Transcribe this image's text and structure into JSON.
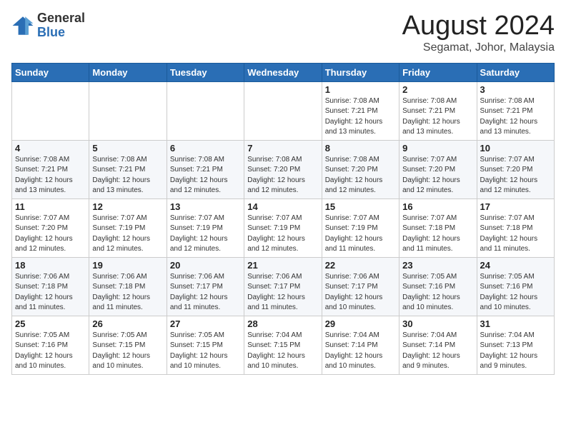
{
  "header": {
    "logo_general": "General",
    "logo_blue": "Blue",
    "month_year": "August 2024",
    "location": "Segamat, Johor, Malaysia"
  },
  "weekdays": [
    "Sunday",
    "Monday",
    "Tuesday",
    "Wednesday",
    "Thursday",
    "Friday",
    "Saturday"
  ],
  "weeks": [
    [
      {
        "day": "",
        "info": ""
      },
      {
        "day": "",
        "info": ""
      },
      {
        "day": "",
        "info": ""
      },
      {
        "day": "",
        "info": ""
      },
      {
        "day": "1",
        "info": "Sunrise: 7:08 AM\nSunset: 7:21 PM\nDaylight: 12 hours\nand 13 minutes."
      },
      {
        "day": "2",
        "info": "Sunrise: 7:08 AM\nSunset: 7:21 PM\nDaylight: 12 hours\nand 13 minutes."
      },
      {
        "day": "3",
        "info": "Sunrise: 7:08 AM\nSunset: 7:21 PM\nDaylight: 12 hours\nand 13 minutes."
      }
    ],
    [
      {
        "day": "4",
        "info": "Sunrise: 7:08 AM\nSunset: 7:21 PM\nDaylight: 12 hours\nand 13 minutes."
      },
      {
        "day": "5",
        "info": "Sunrise: 7:08 AM\nSunset: 7:21 PM\nDaylight: 12 hours\nand 13 minutes."
      },
      {
        "day": "6",
        "info": "Sunrise: 7:08 AM\nSunset: 7:21 PM\nDaylight: 12 hours\nand 12 minutes."
      },
      {
        "day": "7",
        "info": "Sunrise: 7:08 AM\nSunset: 7:20 PM\nDaylight: 12 hours\nand 12 minutes."
      },
      {
        "day": "8",
        "info": "Sunrise: 7:08 AM\nSunset: 7:20 PM\nDaylight: 12 hours\nand 12 minutes."
      },
      {
        "day": "9",
        "info": "Sunrise: 7:07 AM\nSunset: 7:20 PM\nDaylight: 12 hours\nand 12 minutes."
      },
      {
        "day": "10",
        "info": "Sunrise: 7:07 AM\nSunset: 7:20 PM\nDaylight: 12 hours\nand 12 minutes."
      }
    ],
    [
      {
        "day": "11",
        "info": "Sunrise: 7:07 AM\nSunset: 7:20 PM\nDaylight: 12 hours\nand 12 minutes."
      },
      {
        "day": "12",
        "info": "Sunrise: 7:07 AM\nSunset: 7:19 PM\nDaylight: 12 hours\nand 12 minutes."
      },
      {
        "day": "13",
        "info": "Sunrise: 7:07 AM\nSunset: 7:19 PM\nDaylight: 12 hours\nand 12 minutes."
      },
      {
        "day": "14",
        "info": "Sunrise: 7:07 AM\nSunset: 7:19 PM\nDaylight: 12 hours\nand 12 minutes."
      },
      {
        "day": "15",
        "info": "Sunrise: 7:07 AM\nSunset: 7:19 PM\nDaylight: 12 hours\nand 11 minutes."
      },
      {
        "day": "16",
        "info": "Sunrise: 7:07 AM\nSunset: 7:18 PM\nDaylight: 12 hours\nand 11 minutes."
      },
      {
        "day": "17",
        "info": "Sunrise: 7:07 AM\nSunset: 7:18 PM\nDaylight: 12 hours\nand 11 minutes."
      }
    ],
    [
      {
        "day": "18",
        "info": "Sunrise: 7:06 AM\nSunset: 7:18 PM\nDaylight: 12 hours\nand 11 minutes."
      },
      {
        "day": "19",
        "info": "Sunrise: 7:06 AM\nSunset: 7:18 PM\nDaylight: 12 hours\nand 11 minutes."
      },
      {
        "day": "20",
        "info": "Sunrise: 7:06 AM\nSunset: 7:17 PM\nDaylight: 12 hours\nand 11 minutes."
      },
      {
        "day": "21",
        "info": "Sunrise: 7:06 AM\nSunset: 7:17 PM\nDaylight: 12 hours\nand 11 minutes."
      },
      {
        "day": "22",
        "info": "Sunrise: 7:06 AM\nSunset: 7:17 PM\nDaylight: 12 hours\nand 10 minutes."
      },
      {
        "day": "23",
        "info": "Sunrise: 7:05 AM\nSunset: 7:16 PM\nDaylight: 12 hours\nand 10 minutes."
      },
      {
        "day": "24",
        "info": "Sunrise: 7:05 AM\nSunset: 7:16 PM\nDaylight: 12 hours\nand 10 minutes."
      }
    ],
    [
      {
        "day": "25",
        "info": "Sunrise: 7:05 AM\nSunset: 7:16 PM\nDaylight: 12 hours\nand 10 minutes."
      },
      {
        "day": "26",
        "info": "Sunrise: 7:05 AM\nSunset: 7:15 PM\nDaylight: 12 hours\nand 10 minutes."
      },
      {
        "day": "27",
        "info": "Sunrise: 7:05 AM\nSunset: 7:15 PM\nDaylight: 12 hours\nand 10 minutes."
      },
      {
        "day": "28",
        "info": "Sunrise: 7:04 AM\nSunset: 7:15 PM\nDaylight: 12 hours\nand 10 minutes."
      },
      {
        "day": "29",
        "info": "Sunrise: 7:04 AM\nSunset: 7:14 PM\nDaylight: 12 hours\nand 10 minutes."
      },
      {
        "day": "30",
        "info": "Sunrise: 7:04 AM\nSunset: 7:14 PM\nDaylight: 12 hours\nand 9 minutes."
      },
      {
        "day": "31",
        "info": "Sunrise: 7:04 AM\nSunset: 7:13 PM\nDaylight: 12 hours\nand 9 minutes."
      }
    ]
  ]
}
